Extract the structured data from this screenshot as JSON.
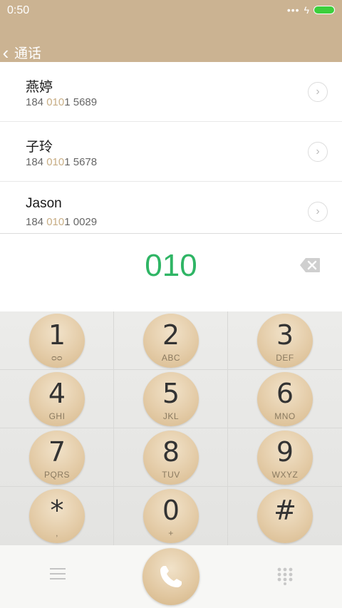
{
  "status": {
    "time": "0:50",
    "dots": "•••",
    "bolt": "ϟ"
  },
  "header": {
    "back_label": "通话",
    "back_glyph": "‹"
  },
  "contacts": [
    {
      "name": "燕婷",
      "number_pre": "184 ",
      "number_hl": "010",
      "number_post": "1 5689"
    },
    {
      "name": "子玲",
      "number_pre": "184 ",
      "number_hl": "010",
      "number_post": "1 5678"
    },
    {
      "name": "Jason",
      "number_pre": "184 ",
      "number_hl": "010",
      "number_post": "1 0029"
    }
  ],
  "chevron": "›",
  "display": {
    "digits": "010"
  },
  "keys": [
    {
      "digit": "1",
      "letters": "ᴑᴑ"
    },
    {
      "digit": "2",
      "letters": "ABC"
    },
    {
      "digit": "3",
      "letters": "DEF"
    },
    {
      "digit": "4",
      "letters": "GHI"
    },
    {
      "digit": "5",
      "letters": "JKL"
    },
    {
      "digit": "6",
      "letters": "MNO"
    },
    {
      "digit": "7",
      "letters": "PQRS"
    },
    {
      "digit": "8",
      "letters": "TUV"
    },
    {
      "digit": "9",
      "letters": "WXYZ"
    },
    {
      "digit": "*",
      "letters": ","
    },
    {
      "digit": "0",
      "letters": "+"
    },
    {
      "digit": "#",
      "letters": ""
    }
  ],
  "colors": {
    "accent": "#2fb565",
    "header": "#cbb392",
    "highlight": "#c7ad84"
  }
}
